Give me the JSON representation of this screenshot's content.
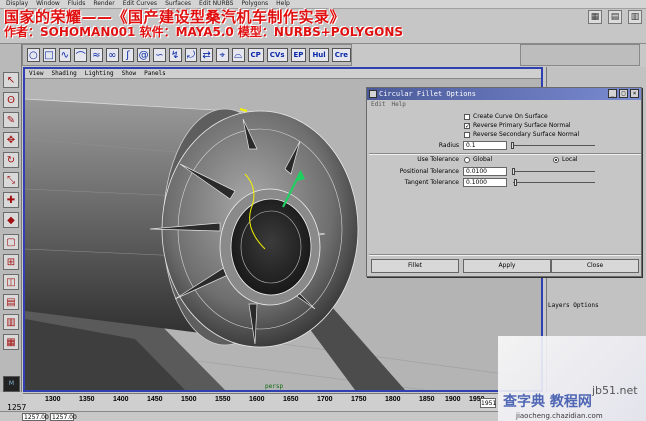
{
  "overlay": {
    "title": "国家的荣耀——《国产建设型桑汽机车制作实录》",
    "credit": "作者：SOHOMAN001 软件：MAYA5.0 模型：NURBS+POLYGONS"
  },
  "menubar": [
    "Display",
    "Window",
    "Fluids",
    "Render",
    "Edit Curves",
    "Surfaces",
    "Edit NURBS",
    "Polygons",
    "Help"
  ],
  "shelf": {
    "labels": [
      "CP",
      "CVs",
      "EP",
      "Hul",
      "Cre"
    ]
  },
  "viewport": {
    "menu": [
      "View",
      "Shading",
      "Lighting",
      "Show",
      "Panels"
    ],
    "footer_label": "persp"
  },
  "dialog": {
    "title": "Circular Fillet Options",
    "menu": [
      "Edit",
      "Help"
    ],
    "checkboxes": [
      {
        "label": "Create Curve On Surface",
        "checked": false
      },
      {
        "label": "Reverse Primary Surface Normal",
        "checked": true
      },
      {
        "label": "Reverse Secondary Surface Normal",
        "checked": false
      }
    ],
    "radius_label": "Radius",
    "radius_value": "0.1",
    "use_tolerance_label": "Use Tolerance",
    "tolerance_options": [
      "Global",
      "Local"
    ],
    "tolerance_selected": "Local",
    "positional_label": "Positional Tolerance",
    "positional_value": "0.0100",
    "tangent_label": "Tangent Tolerance",
    "tangent_value": "0.1000",
    "buttons": [
      "Fillet",
      "Apply",
      "Close"
    ]
  },
  "layers_label": "Layers Options",
  "timeline": {
    "ticks": [
      "1300",
      "1350",
      "1400",
      "1450",
      "1500",
      "1550",
      "1600",
      "1650",
      "1700",
      "1750",
      "1800",
      "1850",
      "1900",
      "1950"
    ],
    "current_left": "1257",
    "current_right": "1951",
    "range_start": "1257.00",
    "range_end": "1257.00"
  },
  "watermark": {
    "site": "jb51.net",
    "brand": "查字典 教程网",
    "url": "jiaocheng.chazidian.com"
  },
  "colors": {
    "viewport_border": "#3040b0",
    "overlay_text": "#e01010",
    "dialog_titlebar": "#4a5a9a"
  }
}
